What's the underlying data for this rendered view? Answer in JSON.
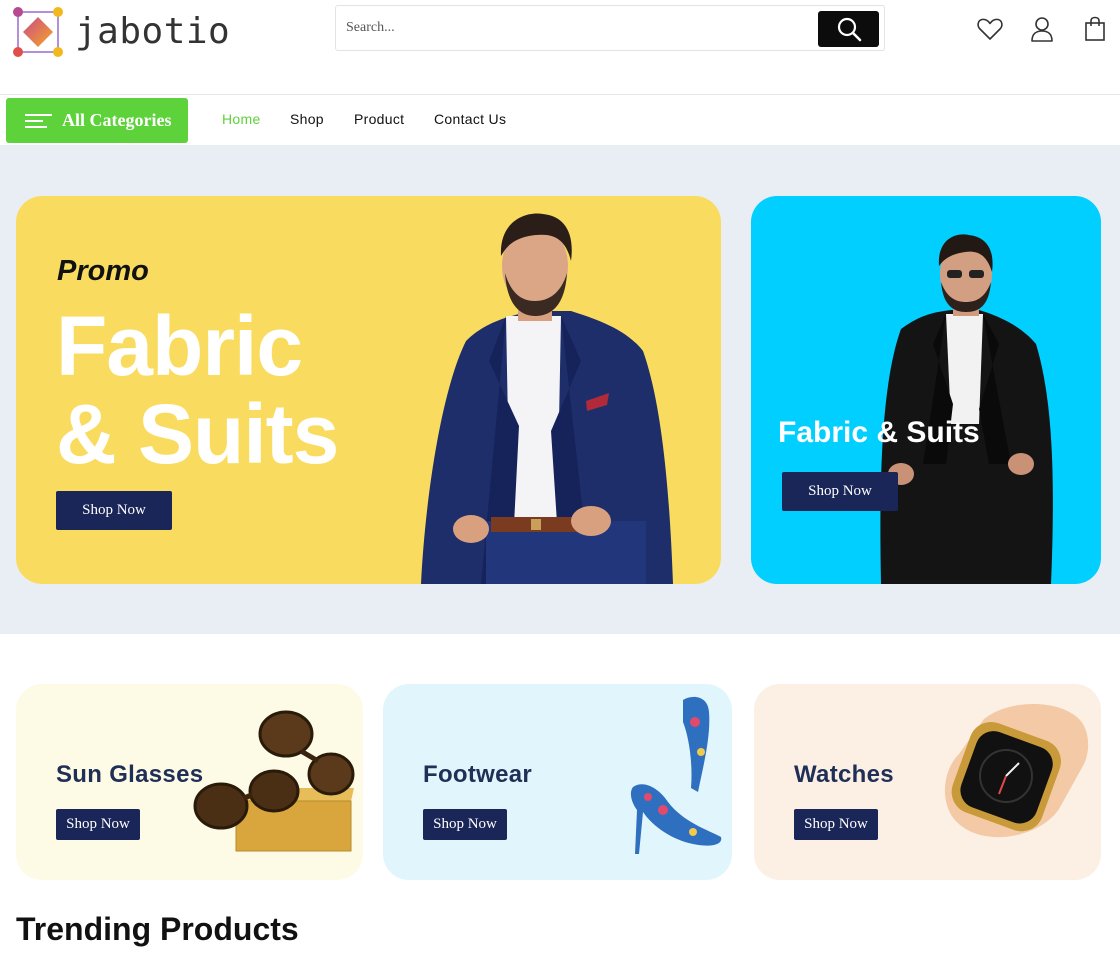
{
  "brand": {
    "name": "jabotio"
  },
  "search": {
    "placeholder": "Search..."
  },
  "header_icons": [
    "heart-icon",
    "user-icon",
    "shopping-bag-icon"
  ],
  "navbar": {
    "categories_label": "All Categories",
    "items": [
      "Home",
      "Shop",
      "Product",
      "Contact Us"
    ],
    "active_index": 0,
    "accent_color": "#5ed23b"
  },
  "hero": {
    "main": {
      "kicker": "Promo",
      "title_line1": "Fabric",
      "title_line2": "& Suits",
      "cta": "Shop Now",
      "bg_color": "#f9dc5f"
    },
    "side": {
      "title": "Fabric & Suits",
      "cta": "Shop Now",
      "bg_color": "#00cfff"
    }
  },
  "categories": [
    {
      "title": "Sun Glasses",
      "cta": "Shop Now",
      "bg_color": "#fdfbe6"
    },
    {
      "title": "Footwear",
      "cta": "Shop Now",
      "bg_color": "#e1f5fc"
    },
    {
      "title": "Watches",
      "cta": "Shop Now",
      "bg_color": "#fcefe4"
    }
  ],
  "sections": {
    "trending_title": "Trending Products"
  },
  "colors": {
    "button_dark": "#1a2558",
    "hero_bg": "#e9eef5"
  }
}
